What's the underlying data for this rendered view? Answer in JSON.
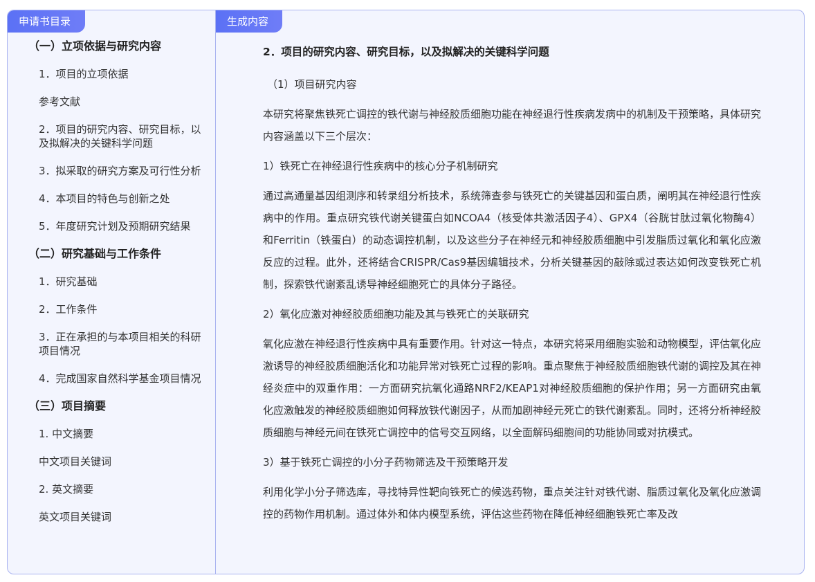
{
  "sidebar": {
    "tab_label": "申请书目录",
    "sections": [
      {
        "title": "（一）立项依据与研究内容",
        "items": [
          "1．项目的立项依据",
          "参考文献",
          "2．项目的研究内容、研究目标，以及拟解决的关键科学问题",
          "3．拟采取的研究方案及可行性分析",
          "4．本项目的特色与创新之处",
          "5．年度研究计划及预期研究结果"
        ]
      },
      {
        "title": "（二）研究基础与工作条件",
        "items": [
          "1．研究基础",
          "2．工作条件",
          "3．正在承担的与本项目相关的科研项目情况",
          "4．完成国家自然科学基金项目情况"
        ]
      },
      {
        "title": "（三）项目摘要",
        "items": [
          "1. 中文摘要",
          "中文项目关键词",
          "2. 英文摘要",
          "英文项目关键词"
        ]
      }
    ]
  },
  "main": {
    "tab_label": "生成内容",
    "heading": "2．项目的研究内容、研究目标，以及拟解决的关键科学问题",
    "sub1": "（1）项目研究内容",
    "intro": "本研究将聚焦铁死亡调控的铁代谢与神经胶质细胞功能在神经退行性疾病发病中的机制及干预策略，具体研究内容涵盖以下三个层次：",
    "part1_title": "1）铁死亡在神经退行性疾病中的核心分子机制研究",
    "part1_text": "通过高通量基因组测序和转录组分析技术，系统筛查参与铁死亡的关键基因和蛋白质，阐明其在神经退行性疾病中的作用。重点研究铁代谢关键蛋白如NCOA4（核受体共激活因子4）、GPX4（谷胱甘肽过氧化物酶4）和Ferritin（铁蛋白）的动态调控机制，以及这些分子在神经元和神经胶质细胞中引发脂质过氧化和氧化应激反应的过程。此外，还将结合CRISPR/Cas9基因编辑技术，分析关键基因的敲除或过表达如何改变铁死亡机制，探索铁代谢紊乱诱导神经细胞死亡的具体分子路径。",
    "part2_title": "2）氧化应激对神经胶质细胞功能及其与铁死亡的关联研究",
    "part2_text": "氧化应激在神经退行性疾病中具有重要作用。针对这一特点，本研究将采用细胞实验和动物模型，评估氧化应激诱导的神经胶质细胞活化和功能异常对铁死亡过程的影响。重点聚焦于神经胶质细胞铁代谢的调控及其在神经炎症中的双重作用：一方面研究抗氧化通路NRF2/KEAP1对神经胶质细胞的保护作用；另一方面研究由氧化应激触发的神经胶质细胞如何释放铁代谢因子，从而加剧神经元死亡的铁代谢紊乱。同时，还将分析神经胶质细胞与神经元间在铁死亡调控中的信号交互网络，以全面解码细胞间的功能协同或对抗模式。",
    "part3_title": "3）基于铁死亡调控的小分子药物筛选及干预策略开发",
    "part3_text": "利用化学小分子筛选库，寻找特异性靶向铁死亡的候选药物，重点关注针对铁代谢、脂质过氧化及氧化应激调控的药物作用机制。通过体外和体内模型系统，评估这些药物在降低神经细胞铁死亡率及改"
  },
  "colors": {
    "accent": "#5b71f5",
    "border": "#a9b3f0",
    "panel_bg": "#f3f5fe"
  }
}
